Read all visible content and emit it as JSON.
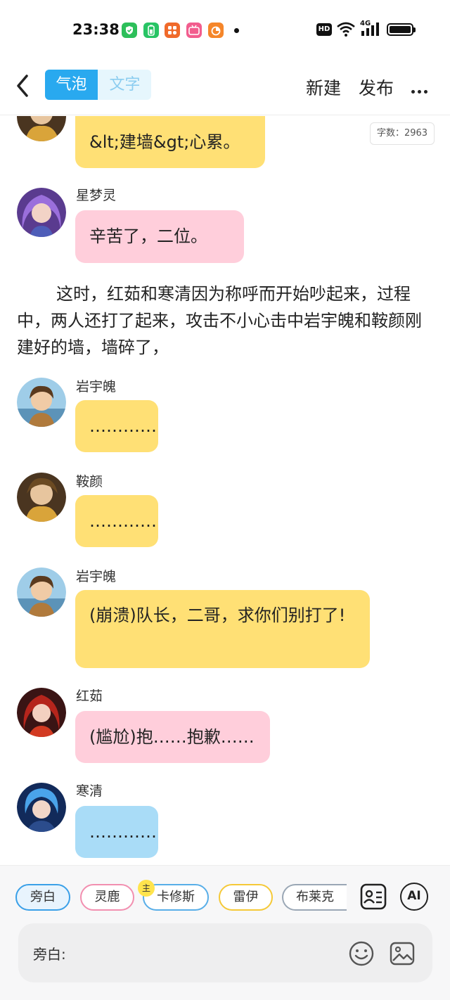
{
  "status_bar": {
    "time": "23:38",
    "hd_label": "HD",
    "network_label": "4G",
    "app_icons": [
      {
        "name": "shield-app-icon",
        "color": "#2dbf5a",
        "glyph": "✓"
      },
      {
        "name": "battery-app-icon",
        "color": "#28c465",
        "glyph": "▮"
      },
      {
        "name": "apps-app-icon",
        "color": "#f06a2b",
        "glyph": "❖"
      },
      {
        "name": "bilibili-app-icon",
        "color": "#f25d8e",
        "glyph": "bili"
      },
      {
        "name": "orange-app-icon",
        "color": "#f5862a",
        "glyph": "◐"
      }
    ]
  },
  "header": {
    "tab_bubble": "气泡",
    "tab_text": "文字",
    "new_label": "新建",
    "publish_label": "发布"
  },
  "word_count": "字数：2963",
  "messages": [
    {
      "type": "bubble",
      "speaker": "",
      "text": "&lt;建墙&gt;心累。",
      "color": "yellow",
      "avatar": "anyan"
    },
    {
      "type": "bubble",
      "speaker": "星梦灵",
      "text": "辛苦了，二位。",
      "color": "pink",
      "avatar": "xingmengling"
    },
    {
      "type": "narration",
      "text": "这时，红茹和寒清因为称呼而开始吵起来，过程中，两人还打了起来，攻击不小心击中岩宇魄和鞍颜刚建好的墙，墙碎了，"
    },
    {
      "type": "bubble",
      "speaker": "岩宇魄",
      "text": "…………",
      "color": "yellow",
      "avatar": "yanyupo"
    },
    {
      "type": "bubble",
      "speaker": "鞍颜",
      "text": "…………",
      "color": "yellow",
      "avatar": "anyan"
    },
    {
      "type": "bubble",
      "speaker": "岩宇魄",
      "text": "(崩溃)队长，二哥，求你们别打了!",
      "color": "yellow",
      "avatar": "yanyupo"
    },
    {
      "type": "bubble",
      "speaker": "红茹",
      "text": "(尴尬)抱……抱歉……",
      "color": "pink",
      "avatar": "hongru"
    },
    {
      "type": "bubble",
      "speaker": "寒清",
      "text": "…………",
      "color": "blue",
      "avatar": "hanqing"
    }
  ],
  "characters": [
    {
      "label": "旁白",
      "border": "#3aa0e8",
      "bg": "#e8f4fd"
    },
    {
      "label": "灵鹿",
      "border": "#f28fb0",
      "bg": "#ffffff"
    },
    {
      "label": "卡修斯",
      "border": "#58aee8",
      "bg": "#ffffff"
    },
    {
      "label": "雷伊",
      "border": "#f5c938",
      "bg": "#ffffff"
    },
    {
      "label": "布莱克",
      "border": "#9aa7b5",
      "bg": "#ffffff"
    }
  ],
  "main_badge": "主",
  "ai_label": "AI",
  "input": {
    "speaker_label": "旁白:",
    "placeholder": ""
  }
}
